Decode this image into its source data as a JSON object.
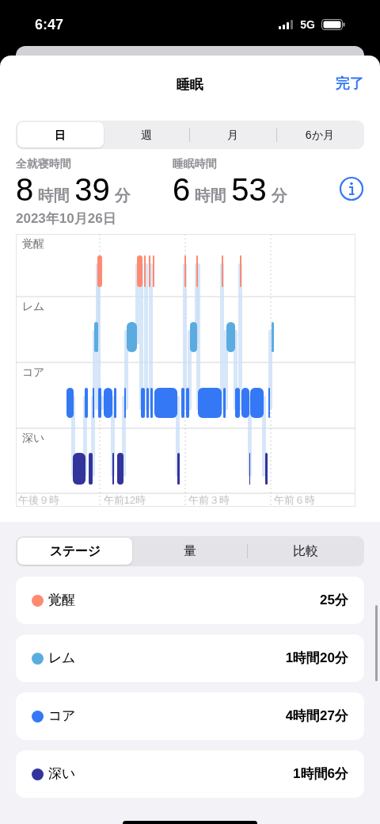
{
  "status_bar": {
    "time": "6:47",
    "network": "5G"
  },
  "nav": {
    "title": "睡眠",
    "done": "完了"
  },
  "range_tabs": [
    {
      "label": "日",
      "selected": true
    },
    {
      "label": "週",
      "selected": false
    },
    {
      "label": "月",
      "selected": false
    },
    {
      "label": "6か月",
      "selected": false
    }
  ],
  "summary": [
    {
      "label": "全就寝時間",
      "parts": [
        {
          "kind": "number",
          "text": "8"
        },
        {
          "kind": "unit",
          "text": "時間"
        },
        {
          "kind": "number",
          "text": "39"
        },
        {
          "kind": "unit",
          "text": "分"
        }
      ]
    },
    {
      "label": "睡眠時間",
      "parts": [
        {
          "kind": "number",
          "text": "6"
        },
        {
          "kind": "unit",
          "text": "時間"
        },
        {
          "kind": "number",
          "text": "53"
        },
        {
          "kind": "unit",
          "text": "分"
        }
      ]
    }
  ],
  "date": "2023年10月26日",
  "chart": {
    "stage_labels": [
      "覚醒",
      "レム",
      "コア",
      "深い"
    ],
    "time_labels": [
      "午後９時",
      "午前12時",
      "午前３時",
      "午前６時"
    ]
  },
  "view_tabs": [
    {
      "label": "ステージ",
      "selected": true
    },
    {
      "label": "量",
      "selected": false
    },
    {
      "label": "比較",
      "selected": false
    }
  ],
  "stages": [
    {
      "name": "覚醒",
      "duration": "25分",
      "color": "#ff8a70"
    },
    {
      "name": "レム",
      "duration": "1時間20分",
      "color": "#5aace0"
    },
    {
      "name": "コア",
      "duration": "4時間27分",
      "color": "#3478f6"
    },
    {
      "name": "深い",
      "duration": "1時間6分",
      "color": "#33339c"
    }
  ]
}
